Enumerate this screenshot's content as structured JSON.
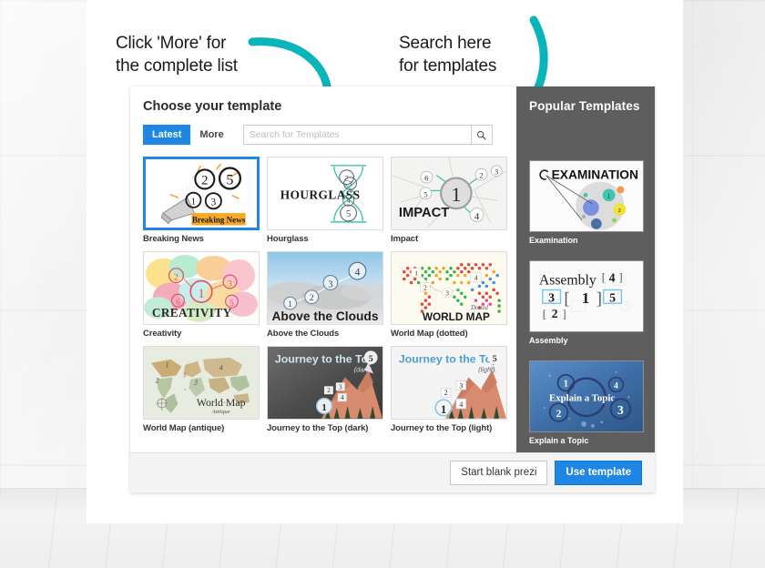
{
  "annotations": {
    "left": "Click 'More' for\nthe complete list",
    "right": "Search here\nfor templates",
    "arrow_color": "#09b5b8"
  },
  "dialog": {
    "title": "Choose your template",
    "tabs": [
      {
        "label": "Latest",
        "active": true
      },
      {
        "label": "More",
        "active": false
      }
    ],
    "search": {
      "placeholder": "Search for Templates",
      "value": "",
      "button_icon": "search-icon"
    },
    "templates": [
      {
        "name": "Breaking News",
        "selected": true
      },
      {
        "name": "Hourglass",
        "selected": false
      },
      {
        "name": "Impact",
        "selected": false
      },
      {
        "name": "Creativity",
        "selected": false
      },
      {
        "name": "Above the Clouds",
        "selected": false
      },
      {
        "name": "World Map (dotted)",
        "selected": false
      },
      {
        "name": "World Map (antique)",
        "selected": false
      },
      {
        "name": "Journey to the Top (dark)",
        "selected": false
      },
      {
        "name": "Journey to the Top (light)",
        "selected": false
      }
    ],
    "sidebar": {
      "title": "Popular Templates",
      "templates": [
        {
          "name": "Examination"
        },
        {
          "name": "Assembly"
        },
        {
          "name": "Explain a Topic"
        }
      ]
    },
    "footer": {
      "blank_label": "Start blank prezi",
      "use_label": "Use template",
      "accent_color": "#1e87e5"
    }
  },
  "thumb_art": {
    "breaking_news": {
      "banner": "Breaking News",
      "numbers": [
        "2",
        "5",
        "1",
        "3"
      ]
    },
    "hourglass": {
      "title": "HOURGLASS",
      "numbers": [
        "2",
        "3",
        "4",
        "5"
      ]
    },
    "impact": {
      "title": "IMPACT",
      "numbers": [
        "6",
        "2",
        "3",
        "5",
        "1",
        "4"
      ]
    },
    "creativity": {
      "title": "CREATIVITY",
      "numbers": [
        "2",
        "3",
        "1",
        "6",
        "5"
      ]
    },
    "clouds": {
      "title": "Above the Clouds",
      "numbers": [
        "4",
        "3",
        "2",
        "1"
      ]
    },
    "worldmap_dotted": {
      "title": "WORLD MAP",
      "subtitle": "Dotted",
      "numbers": [
        "1",
        "2",
        "3",
        "4"
      ]
    },
    "worldmap_antique": {
      "title": "World Map",
      "subtitle": "Antique",
      "numbers": [
        "1",
        "2",
        "3",
        "4",
        "5"
      ]
    },
    "journey_dark": {
      "title": "Journey to the Top",
      "subtitle": "(dark)",
      "numbers": [
        "5",
        "3",
        "2",
        "4",
        "1"
      ]
    },
    "journey_light": {
      "title": "Journey to the Top",
      "subtitle": "(light)",
      "numbers": [
        "5",
        "3",
        "2",
        "4",
        "1"
      ]
    },
    "examination": {
      "title": "EXAMINATION"
    },
    "assembly": {
      "title": "Assembly",
      "numbers": [
        "4",
        "3",
        "1",
        "5",
        "2"
      ]
    },
    "explain": {
      "title": "Explain a Topic",
      "numbers": [
        "1",
        "4",
        "2",
        "3"
      ]
    }
  }
}
